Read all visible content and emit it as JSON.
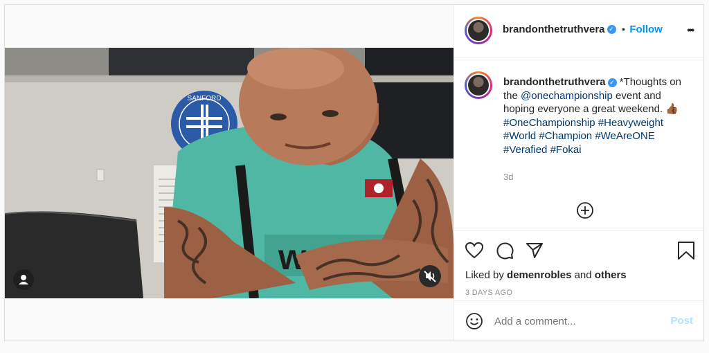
{
  "post": {
    "username": "brandonthetruthvera",
    "follow_label": "Follow",
    "dot": "•",
    "more_label": "•••",
    "caption": {
      "text_start": "*Thoughts on the ",
      "mention": "@onechampionship",
      "text_mid": " event and hoping everyone a great weekend. ",
      "emoji": "👍🏾",
      "hashtags": [
        "#OneChampionship",
        "#Heavyweight",
        "#World",
        "#Champion",
        "#WeAreONE",
        "#Verafied",
        "#Fokai"
      ]
    },
    "caption_age": "3d",
    "liked_by_prefix": "Liked by ",
    "liked_by_user": "demenrobles",
    "liked_by_and": " and ",
    "liked_by_others": "others",
    "timestamp": "3 DAYS AGO",
    "comment_placeholder": "Add a comment...",
    "post_button": "Post",
    "video_overlay": {
      "badge_text": "wat",
      "sign_text": "SANFORD"
    }
  },
  "colors": {
    "accent": "#0095f6",
    "link": "#00376b",
    "jersey": "#4fb7a3"
  },
  "icons": [
    "user-icon",
    "mute-icon",
    "heart-icon",
    "comment-icon",
    "share-icon",
    "bookmark-icon",
    "plus-circle-icon",
    "emoji-icon",
    "verified-icon",
    "more-icon"
  ]
}
